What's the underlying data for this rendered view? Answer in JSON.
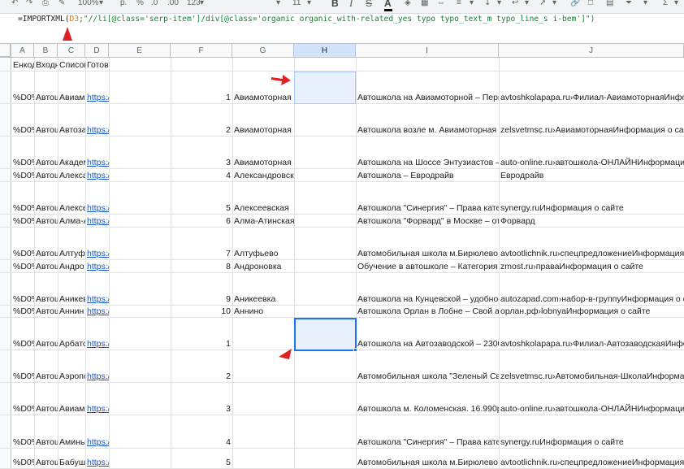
{
  "toolbar": {
    "zoom": "100%",
    "currency": "р.",
    "percent": "%",
    "dec_decrease": ".0",
    "dec_increase": ".00",
    "number_format": "123",
    "font_size": "11",
    "bold": "B",
    "italic": "I",
    "strike": "S",
    "text_color": "A"
  },
  "formula": {
    "prefix": "=IMPORTXML(",
    "ref": "D3",
    "rest": ";\"//li[@class='serp-item']/div[@class='organic organic_with-related_yes typo typo_text_m typo_line_s i-bem']\")"
  },
  "columns": [
    "A",
    "B",
    "C",
    "D",
    "E",
    "F",
    "G",
    "H",
    "I",
    "J"
  ],
  "header_row": {
    "A": "Енкод",
    "B": "Входн",
    "C": "Список",
    "D": "Готов"
  },
  "rows": [
    {
      "num": "",
      "A": "",
      "B": "",
      "C": "",
      "D": "",
      "F": "",
      "G": "",
      "I": "",
      "J": ""
    },
    {
      "num": "",
      "A": "%D0%",
      "B": "Автош",
      "C": "Авиам",
      "D": "https:/",
      "F": "1",
      "G": "Авиамоторная",
      "I": "Автошкола на Авиамоторной – Первы",
      "J": "avtoshkolapapa.ru›Филиал-АвиамоторнаяИнформ"
    },
    {
      "num": "",
      "A": "%D0%",
      "B": "Автош",
      "C": "Автоза",
      "D": "https:/",
      "F": "2",
      "G": "Авиамоторная",
      "I": "Автошкола возле м. Авиамоторная – с",
      "J": "zelsvetmsc.ru›АвиамоторнаяИнформация о сайте"
    },
    {
      "num": "",
      "A": "%D0%",
      "B": "Автош",
      "C": "Академ",
      "D": "https:/",
      "F": "3",
      "G": "Авиамоторная",
      "I": "Автошкола на Шоссе Энтузиастов – 5",
      "J": "auto-online.ru›автошкола-ОНЛАЙНИнформация о"
    },
    {
      "num": "",
      "A": "%D0%",
      "B": "Автош",
      "C": "Алекса",
      "D": "https:/",
      "F": "4",
      "G": "Александровски",
      "I": "Автошкола – Евродрайв",
      "J": "Евродрайв"
    },
    {
      "num": "",
      "A": "%D0%",
      "B": "Автош",
      "C": "Алексе",
      "D": "https:/",
      "F": "5",
      "G": "Алексеевская",
      "I": "Автошкола \"Синергия\" – Права катего",
      "J": "synergy.ruИнформация о сайте"
    },
    {
      "num": "",
      "A": "%D0%",
      "B": "Автош",
      "C": "Алма-А",
      "D": "https:/",
      "F": "6",
      "G": "Алма-Атинская",
      "I": "Автошкола \"Форвард\" в Москве – отз",
      "J": "Форвард"
    },
    {
      "num": "",
      "A": "%D0%",
      "B": "Автош",
      "C": "Алтуфь",
      "D": "https:/",
      "F": "7",
      "G": "Алтуфьево",
      "I": "Автомобильная школа м.Бирюлево –",
      "J": "avtootlichnik.ru›спецпредложениеИнформация о с"
    },
    {
      "num": "",
      "A": "%D0%",
      "B": "Автош",
      "C": "Андро",
      "D": "https:/",
      "F": "8",
      "G": "Андроновка",
      "I": "Обучение в автошколе – Категория ВЕ",
      "J": "zmost.ru›праваИнформация о сайте"
    },
    {
      "num": "",
      "A": "%D0%",
      "B": "Автош",
      "C": "Аникев",
      "D": "https:/",
      "F": "9",
      "G": "Аникеевка",
      "I": "Автошкола на Кунцевской – удобное р",
      "J": "autozapad.com›набор-в-группуИнформация о сайт"
    },
    {
      "num": "",
      "A": "%D0%",
      "B": "Автош",
      "C": "Аннин",
      "D": "https:/",
      "F": "10",
      "G": "Аннино",
      "I": "Автошкола Орлан в Лобне – Свой авт",
      "J": "орлан.рф›lobnyaИнформация о сайте"
    },
    {
      "num": "",
      "A": "%D0%",
      "B": "Автош",
      "C": "Арбатс",
      "D": "https:/",
      "F": "1",
      "G": "",
      "I": "Автошкола на Автозаводской – 23000",
      "J": "avtoshkolapapa.ru›Филиал-АвтозаводскаяИнформ"
    },
    {
      "num": "",
      "A": "%D0%",
      "B": "Автош",
      "C": "Аэропо",
      "D": "https:/",
      "F": "2",
      "G": "",
      "I": "Автомобильная школа \"Зеленый Свет",
      "J": "zelsvetmsc.ru›Автомобильная-ШколаИнформация"
    },
    {
      "num": "",
      "A": "%D0%",
      "B": "Автош",
      "C": "Авиам",
      "D": "https:/",
      "F": "3",
      "G": "",
      "I": "Автошкола м. Коломенская. 16.990р –",
      "J": "auto-online.ru›автошкола-ОНЛАЙНИнформация о"
    },
    {
      "num": "",
      "A": "%D0%",
      "B": "Автош",
      "C": "Амины",
      "D": "https:/",
      "F": "4",
      "G": "",
      "I": "Автошкола \"Синергия\" – Права катего",
      "J": "synergy.ruИнформация о сайте"
    },
    {
      "num": "",
      "A": "%D0%",
      "B": "Автош",
      "C": "Бабуш",
      "D": "https:/",
      "F": "5",
      "G": "",
      "I": "Автомобильная школа м.Бирюлево –",
      "J": "avtootlichnik.ru›спецпредложениеИнформация о с"
    }
  ],
  "colors": {
    "selection_border": "#1a73e8",
    "selection_fill": "#e8f0fe",
    "arrow_red": "#e02020",
    "link": "#1155cc",
    "formula_ref": "#e37400",
    "formula_string": "#188038"
  }
}
